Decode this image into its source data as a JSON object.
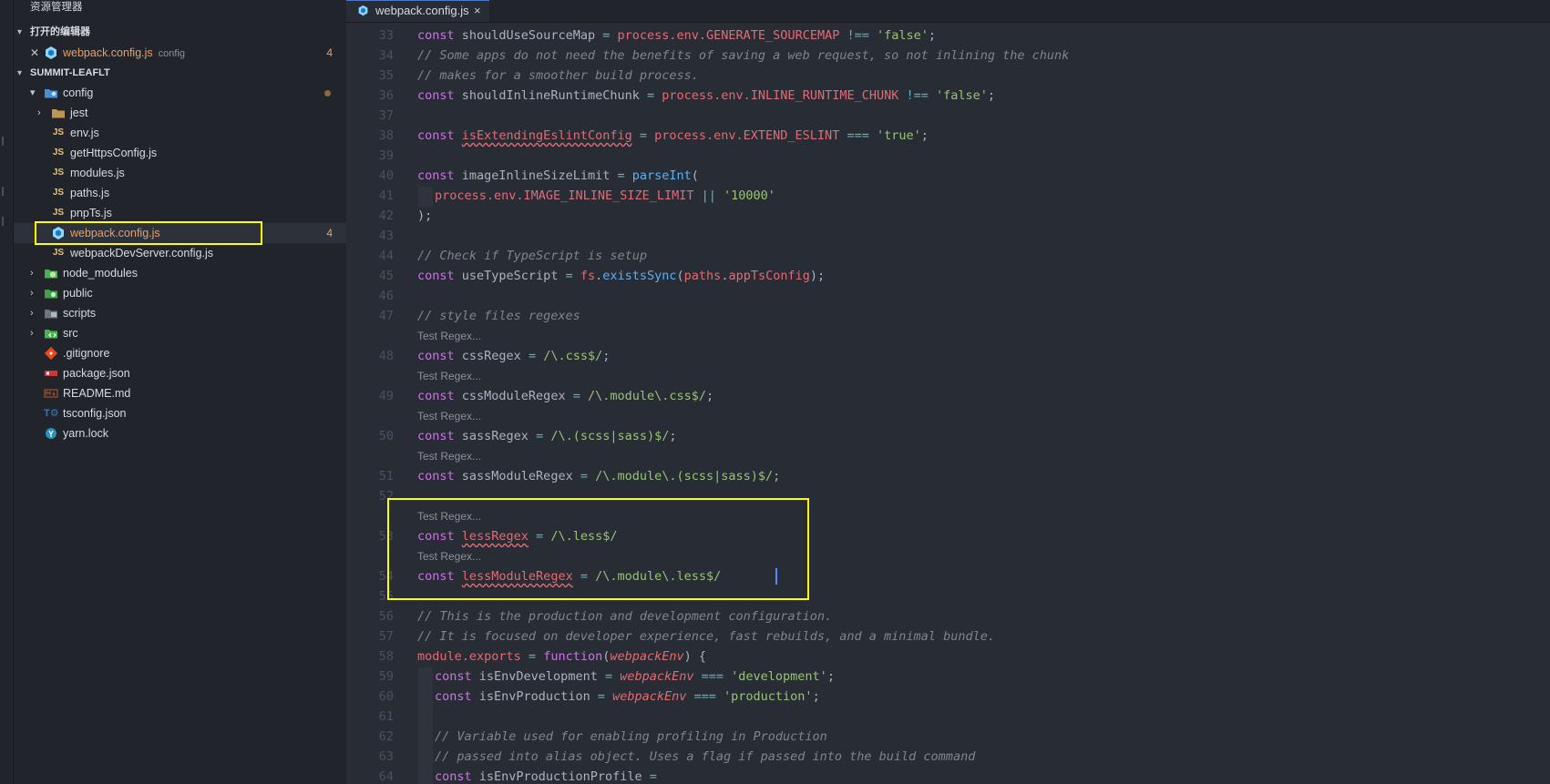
{
  "sidebar": {
    "title": "资源管理器",
    "open_editors_header": "打开的编辑器",
    "open_editor": {
      "name": "webpack.config.js",
      "desc": "config",
      "badge": "4"
    },
    "project_header": "SUMMIT-LEAFLT",
    "config_folder": "config",
    "config_children": [
      "jest",
      "env.js",
      "getHttpsConfig.js",
      "modules.js",
      "paths.js",
      "pnpTs.js",
      "webpack.config.js",
      "webpackDevServer.config.js"
    ],
    "webpack_badge": "4",
    "root_folders": [
      "node_modules",
      "public",
      "scripts",
      "src"
    ],
    "root_files": [
      ".gitignore",
      "package.json",
      "README.md",
      "tsconfig.json",
      "yarn.lock"
    ]
  },
  "tab": {
    "label": "webpack.config.js",
    "close": "×"
  },
  "editor": {
    "code_lens_label": "Test Regex...",
    "line_numbers": [
      "33",
      "34",
      "35",
      "36",
      "37",
      "38",
      "39",
      "40",
      "41",
      "42",
      "43",
      "44",
      "45",
      "46",
      "47",
      "48",
      "49",
      "50",
      "51",
      "52",
      "53",
      "54",
      "55",
      "56",
      "57",
      "58",
      "59",
      "60",
      "61",
      "62",
      "63",
      "64"
    ],
    "tokens": {
      "const": "const",
      "eq": " = ",
      "neq": " !== ",
      "seq": " === ",
      "process_env": "process.env.",
      "false_str": "'false'",
      "true_str": "'true'",
      "semi": ";",
      "l33_name": "shouldUseSourceMap",
      "l33_prop": "GENERATE_SOURCEMAP",
      "l34": "// Some apps do not need the benefits of saving a web request, so not inlining the chunk",
      "l35": "// makes for a smoother build process.",
      "l36_name": "shouldInlineRuntimeChunk",
      "l36_prop": "INLINE_RUNTIME_CHUNK",
      "l38_name": "isExtendingEslintConfig",
      "l38_prop": "EXTEND_ESLINT",
      "l40_name": "imageInlineSizeLimit",
      "l40_fn": "parseInt",
      "l40_paren": "(",
      "l41_process": "process",
      "l41_env": ".env.",
      "l41_prop": "IMAGE_INLINE_SIZE_LIMIT",
      "l41_or": " || ",
      "l41_str": "'10000'",
      "l42": ");",
      "l44": "// Check if TypeScript is setup",
      "l45_name": "useTypeScript",
      "l45_fs": "fs",
      "l45_fn": "existsSync",
      "l45_paths": "paths",
      "l45_prop": "appTsConfig",
      "l47": "// style files regexes",
      "l48_name": "cssRegex",
      "l48_rx": "/\\.css$/",
      "l49_name": "cssModuleRegex",
      "l49_rx": "/\\.module\\.css$/",
      "l50_name": "sassRegex",
      "l50_rx": "/\\.(scss|sass)$/",
      "l51_name": "sassModuleRegex",
      "l51_rx": "/\\.module\\.(scss|sass)$/",
      "l53_name": "lessRegex",
      "l53_rx": "/\\.less$/",
      "l54_name": "lessModuleRegex",
      "l54_rx": "/\\.module\\.less$/",
      "l56": "// This is the production and development configuration.",
      "l57": "// It is focused on developer experience, fast rebuilds, and a minimal bundle.",
      "l58_module": "module",
      "l58_exports": ".exports",
      "l58_fn": "function",
      "l58_param": "webpackEnv",
      "l58_tail": ") {",
      "l59_name": "isEnvDevelopment",
      "l59_param": "webpackEnv",
      "l59_str": "'development'",
      "l60_name": "isEnvProduction",
      "l60_param": "webpackEnv",
      "l60_str": "'production'",
      "l62": "// Variable used for enabling profiling in Production",
      "l63": "// passed into alias object. Uses a flag if passed into the build command",
      "l64_name": "isEnvProductionProfile",
      "l64_eq": " ="
    }
  },
  "colors": {
    "highlight_box": "#ffff00",
    "accent": "#4d78cc",
    "badge": "#e5a06b"
  }
}
